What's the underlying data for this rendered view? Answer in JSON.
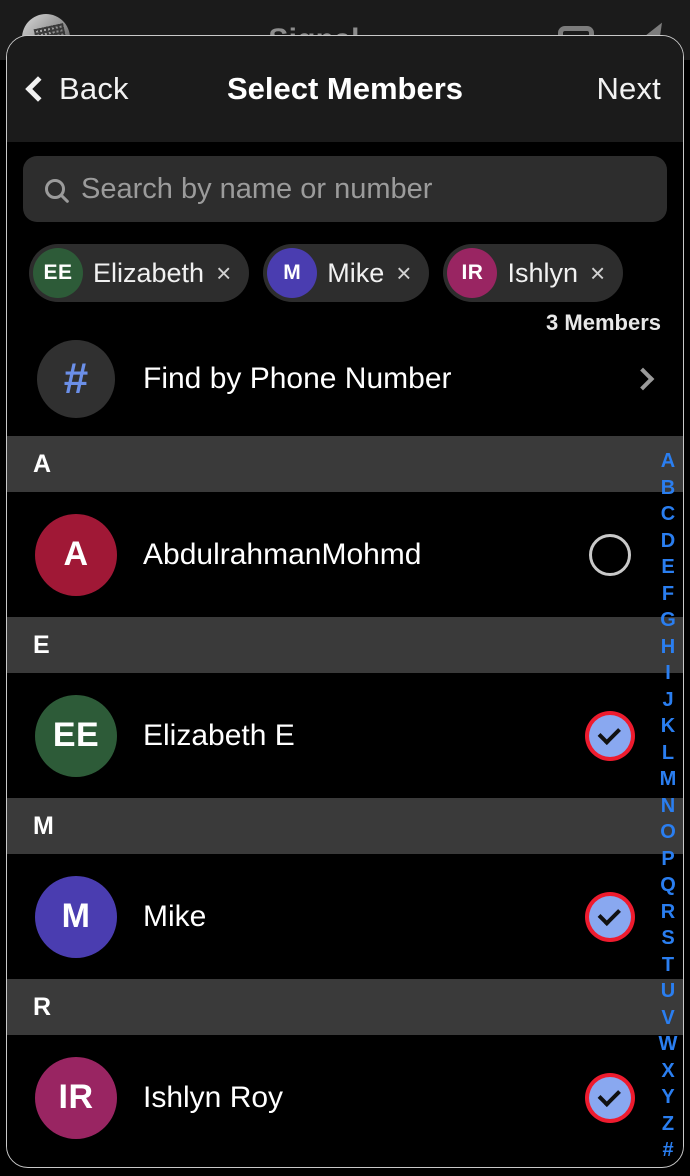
{
  "background_app": {
    "title": "Signal",
    "avatar_icon": "profile-avatar-icon",
    "camera_icon": "camera-icon",
    "compose_icon": "compose-pencil-icon"
  },
  "navbar": {
    "back_label": "Back",
    "back_icon": "chevron-left-icon",
    "title": "Select Members",
    "next_label": "Next"
  },
  "search": {
    "placeholder": "Search by name or number",
    "value": "",
    "icon": "search-icon"
  },
  "selected_chips": [
    {
      "initials": "EE",
      "name": "Elizabeth",
      "color": "#2d5b38",
      "remove_icon": "close-x-icon",
      "remove_label": "×"
    },
    {
      "initials": "M",
      "name": "Mike",
      "color": "#4a3db0",
      "remove_icon": "close-x-icon",
      "remove_label": "×"
    },
    {
      "initials": "IR",
      "name": "Ishlyn",
      "color": "#992562",
      "remove_icon": "close-x-icon",
      "remove_label": "×"
    }
  ],
  "members_count_label": "3 Members",
  "find_by_phone": {
    "label": "Find by Phone Number",
    "icon": "hash-icon",
    "icon_glyph": "#",
    "chevron_icon": "chevron-right-icon"
  },
  "contact_sections": [
    {
      "letter": "A",
      "contacts": [
        {
          "initials": "A",
          "name": "AbdulrahmanMohmd",
          "color": "#a01836",
          "selected": false
        }
      ]
    },
    {
      "letter": "E",
      "contacts": [
        {
          "initials": "EE",
          "name": "Elizabeth E",
          "color": "#2d5b38",
          "selected": true
        }
      ]
    },
    {
      "letter": "M",
      "contacts": [
        {
          "initials": "M",
          "name": "Mike",
          "color": "#4a3db0",
          "selected": true
        }
      ]
    },
    {
      "letter": "R",
      "contacts": [
        {
          "initials": "IR",
          "name": "Ishlyn Roy",
          "color": "#992562",
          "selected": true
        }
      ]
    }
  ],
  "index_rail": [
    "A",
    "B",
    "C",
    "D",
    "E",
    "F",
    "G",
    "H",
    "I",
    "J",
    "K",
    "L",
    "M",
    "N",
    "O",
    "P",
    "Q",
    "R",
    "S",
    "T",
    "U",
    "V",
    "W",
    "X",
    "Y",
    "Z",
    "#"
  ],
  "colors": {
    "accent_blue": "#2a7ef0",
    "check_fill": "#89a8f0",
    "highlight_ring": "#ee1b2e",
    "sheet_bg": "#000000",
    "navbar_bg": "#1b1b1b",
    "section_header_bg": "#3a3a3a",
    "search_bg": "#2d2d2d",
    "chip_bg": "#2d2d2d"
  }
}
